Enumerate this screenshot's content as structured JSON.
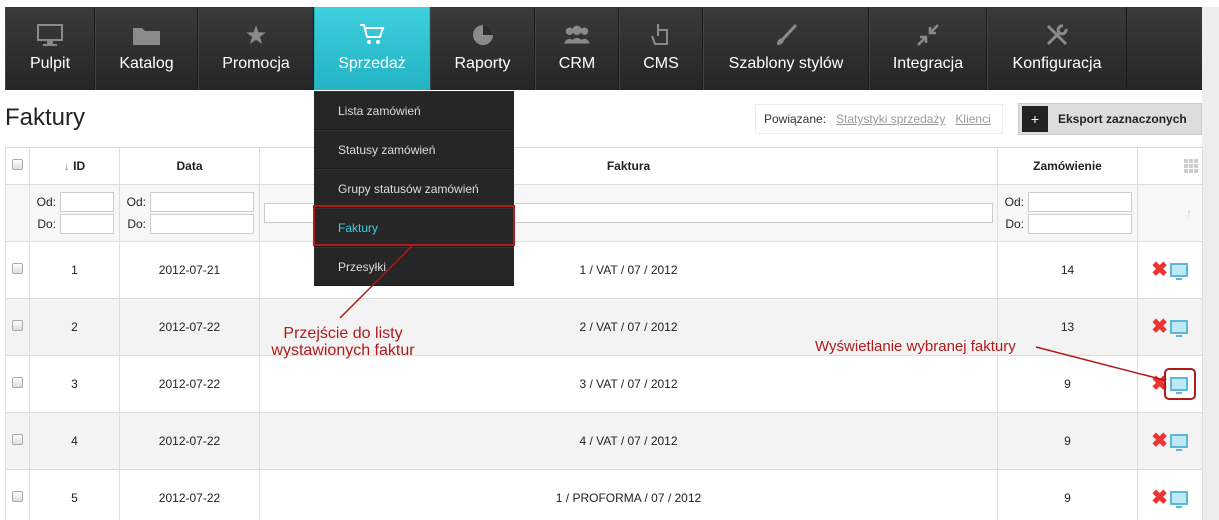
{
  "nav": [
    {
      "label": "Pulpit",
      "icon": "monitor-icon"
    },
    {
      "label": "Katalog",
      "icon": "folder-icon"
    },
    {
      "label": "Promocja",
      "icon": "star-icon"
    },
    {
      "label": "Sprzedaż",
      "icon": "cart-icon",
      "active": true
    },
    {
      "label": "Raporty",
      "icon": "pie-chart-icon"
    },
    {
      "label": "CRM",
      "icon": "users-icon"
    },
    {
      "label": "CMS",
      "icon": "hand-pointer-icon"
    },
    {
      "label": "Szablony stylów",
      "icon": "brush-icon"
    },
    {
      "label": "Integracja",
      "icon": "arrows-in-icon"
    },
    {
      "label": "Konfiguracja",
      "icon": "tools-icon"
    }
  ],
  "dropdown": [
    "Lista zamówień",
    "Statusy zamówień",
    "Grupy statusów zamówień",
    "Faktury",
    "Przesyłki"
  ],
  "page": {
    "title": "Faktury"
  },
  "related": {
    "label": "Powiązane:",
    "links": [
      "Statystyki sprzedaży",
      "Klienci"
    ]
  },
  "export": {
    "label": "Eksport zaznaczonych",
    "plus": "+"
  },
  "table": {
    "headers": {
      "id": "ID",
      "date": "Data",
      "invoice": "Faktura",
      "order": "Zamówienie"
    },
    "filter": {
      "from": "Od:",
      "to": "Do:"
    },
    "rows": [
      {
        "id": "1",
        "date": "2012-07-21",
        "invoice": "1 / VAT / 07 / 2012",
        "order": "14"
      },
      {
        "id": "2",
        "date": "2012-07-22",
        "invoice": "2 / VAT / 07 / 2012",
        "order": "13"
      },
      {
        "id": "3",
        "date": "2012-07-22",
        "invoice": "3 / VAT / 07 / 2012",
        "order": "9"
      },
      {
        "id": "4",
        "date": "2012-07-22",
        "invoice": "4 / VAT / 07 / 2012",
        "order": "9"
      },
      {
        "id": "5",
        "date": "2012-07-22",
        "invoice": "1 / PROFORMA / 07 / 2012",
        "order": "9"
      }
    ]
  },
  "annotations": {
    "note1_line1": "Przejście do listy",
    "note1_line2": "wystawionych faktur",
    "note2": "Wyświetlanie wybranej faktury"
  },
  "colors": {
    "accent": "#2fc3d2",
    "annotation": "#b01a1a"
  }
}
